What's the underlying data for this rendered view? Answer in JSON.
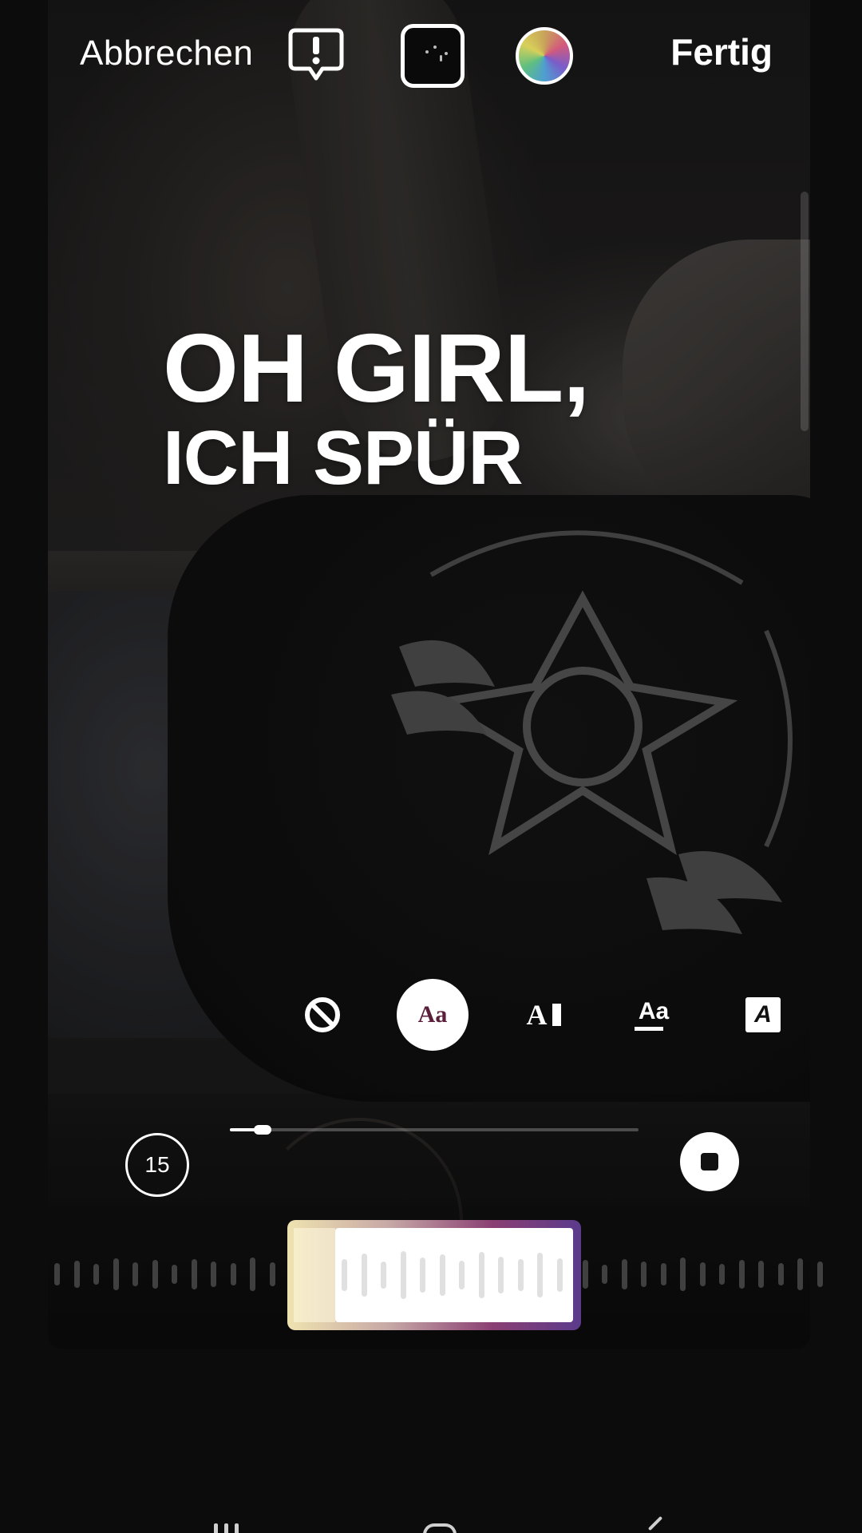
{
  "topbar": {
    "cancel_label": "Abbrechen",
    "done_label": "Fertig",
    "alert_icon": "alert-bubble-icon",
    "thumbnail_icon": "media-thumbnail",
    "color_icon": "color-wheel-icon"
  },
  "lyrics": {
    "line1": "OH GIRL,",
    "line2": "ICH SPÜR"
  },
  "style_options": {
    "none_icon": "no-style-icon",
    "active_label": "Aa",
    "cursor_label": "A",
    "underline_label": "Aa",
    "box_label": "A"
  },
  "playback": {
    "duration_label": "15",
    "progress": 0.08,
    "stop_icon": "stop-icon"
  },
  "colors": {
    "accent_active_text": "#5a1f3a",
    "clip_gradient_start": "#efe3b0",
    "clip_gradient_end": "#5b3b8c"
  }
}
